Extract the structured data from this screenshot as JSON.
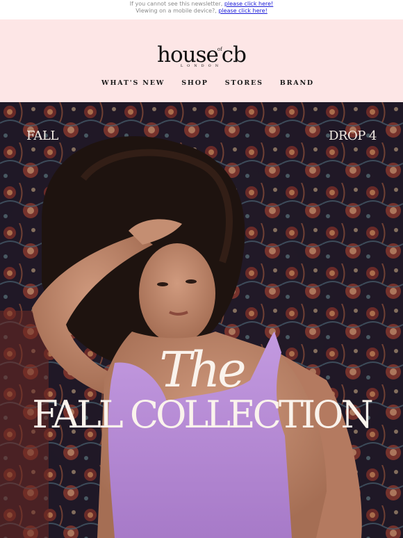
{
  "preheader": {
    "line1_text": "If you cannot see this newsletter,",
    "line1_link": "please click here!",
    "line2_text": "Viewing on a mobile device?,",
    "line2_link": "please click here!"
  },
  "brand": {
    "logo_house": "house",
    "logo_of": "of",
    "logo_cb": "cb",
    "logo_sub": "LONDON"
  },
  "nav": {
    "items": [
      {
        "label": "WHAT'S NEW"
      },
      {
        "label": "SHOP"
      },
      {
        "label": "STORES"
      },
      {
        "label": "BRAND"
      }
    ]
  },
  "hero": {
    "left_label": "FALL",
    "right_label": "DROP 4",
    "script_title": "The",
    "main_title": "FALL COLLECTION"
  },
  "colors": {
    "header_bg": "#fde6e6",
    "link": "#1a1ad8",
    "hero_text": "#faf3ec",
    "dress": "#b98ad3"
  }
}
